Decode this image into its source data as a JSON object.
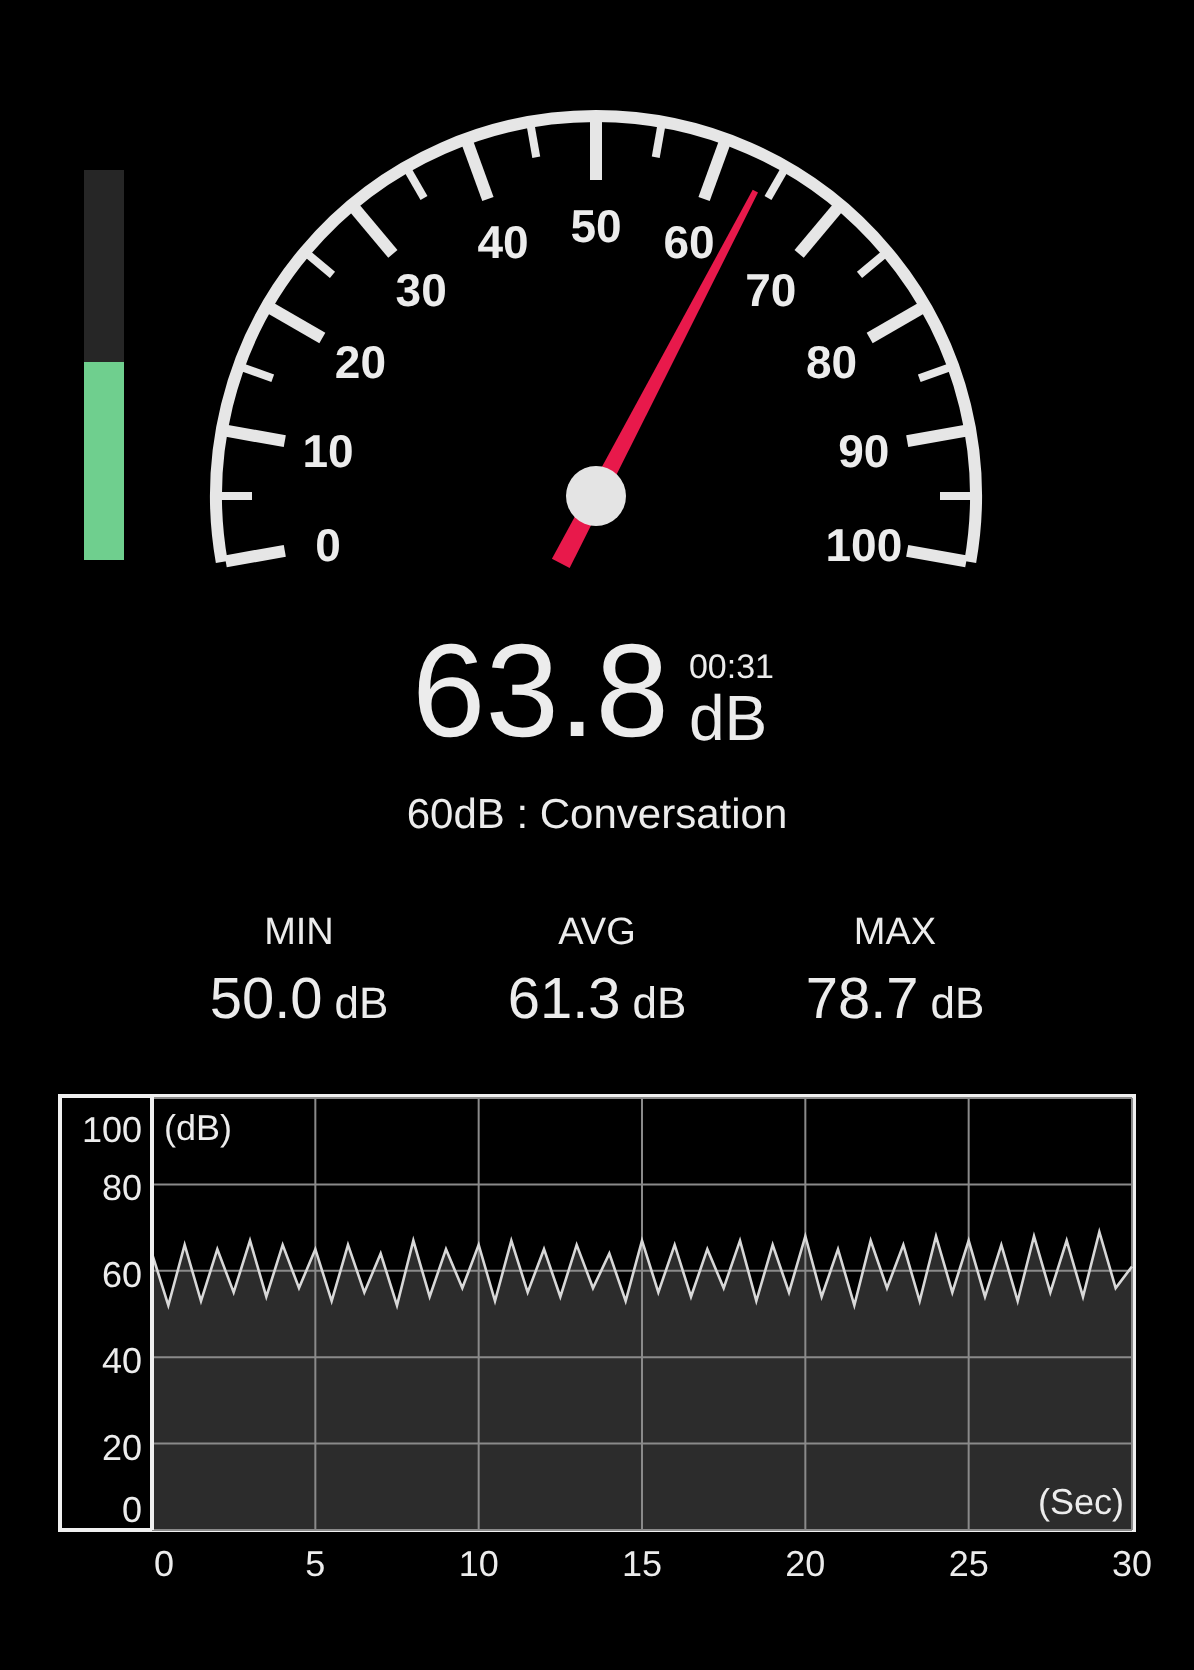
{
  "level_meter": {
    "level": 0.51
  },
  "gauge": {
    "labels": [
      "50",
      "40",
      "60",
      "30",
      "70",
      "20",
      "80",
      "10",
      "90",
      "0",
      "100"
    ]
  },
  "reading": {
    "value": "63.8",
    "elapsed": "00:31",
    "unit": "dB"
  },
  "description": "60dB : Conversation",
  "stats": [
    {
      "label": "MIN",
      "value": "50.0",
      "unit": "dB"
    },
    {
      "label": "AVG",
      "value": "61.3",
      "unit": "dB"
    },
    {
      "label": "MAX",
      "value": "78.7",
      "unit": "dB"
    }
  ],
  "history": {
    "chart_data": {
      "type": "area",
      "xlabel": "(Sec)",
      "ylabel": "(dB)",
      "x": [
        0,
        0.5,
        1,
        1.5,
        2,
        2.5,
        3,
        3.5,
        4,
        4.5,
        5,
        5.5,
        6,
        6.5,
        7,
        7.5,
        8,
        8.5,
        9,
        9.5,
        10,
        10.5,
        11,
        11.5,
        12,
        12.5,
        13,
        13.5,
        14,
        14.5,
        15,
        15.5,
        16,
        16.5,
        17,
        17.5,
        18,
        18.5,
        19,
        19.5,
        20,
        20.5,
        21,
        21.5,
        22,
        22.5,
        23,
        23.5,
        24,
        24.5,
        25,
        25.5,
        26,
        26.5,
        27,
        27.5,
        28,
        28.5,
        29,
        29.5,
        30
      ],
      "series": [
        {
          "color": "#d8d8d8",
          "values": [
            64,
            52,
            66,
            53,
            65,
            55,
            67,
            54,
            66,
            56,
            65,
            53,
            66,
            55,
            64,
            52,
            67,
            54,
            65,
            56,
            66,
            53,
            67,
            55,
            65,
            54,
            66,
            56,
            64,
            53,
            67,
            55,
            66,
            54,
            65,
            56,
            67,
            53,
            66,
            55,
            68,
            54,
            65,
            52,
            67,
            56,
            66,
            53,
            68,
            55,
            67,
            54,
            66,
            53,
            68,
            55,
            67,
            54,
            69,
            56,
            61
          ]
        }
      ],
      "grid": true,
      "xlim": [
        0,
        30
      ],
      "ylim": [
        0,
        100
      ],
      "xticks": [
        0,
        5,
        10,
        15,
        20,
        25,
        30
      ],
      "yticks": [
        0,
        20,
        40,
        60,
        80,
        100
      ]
    }
  }
}
